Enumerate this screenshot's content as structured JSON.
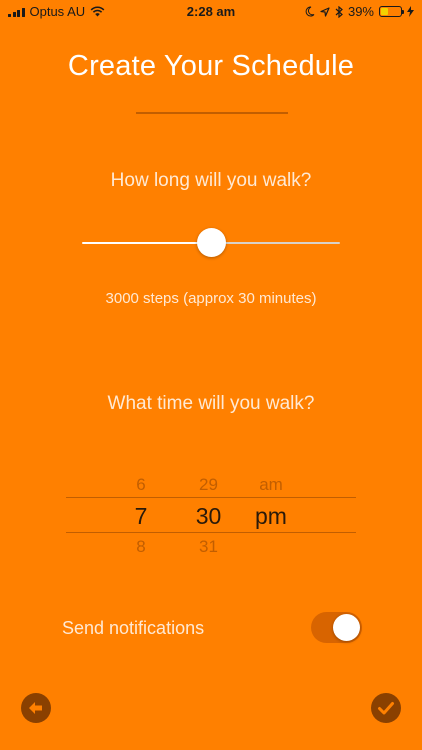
{
  "status_bar": {
    "carrier": "Optus AU",
    "time": "2:28 am",
    "battery": "39%",
    "battery_level": 0.39
  },
  "title": "Create Your Schedule",
  "walk_length": {
    "question": "How long will you walk?",
    "slider_value": 0.5,
    "summary": "3000 steps (approx 30 minutes)"
  },
  "walk_time": {
    "question": "What time will you walk?",
    "hour": {
      "prev": "6",
      "selected": "7",
      "next": "8"
    },
    "minute": {
      "prev": "29",
      "selected": "30",
      "next": "31"
    },
    "period": {
      "prev": "am",
      "selected": "pm",
      "next": ""
    }
  },
  "notifications": {
    "label": "Send notifications",
    "enabled": true
  },
  "colors": {
    "background": "#FF8000",
    "divider": "#C25E00",
    "button": "#8A4000"
  },
  "icons": {
    "back": "arrow-left-icon",
    "confirm": "checkmark-icon"
  }
}
